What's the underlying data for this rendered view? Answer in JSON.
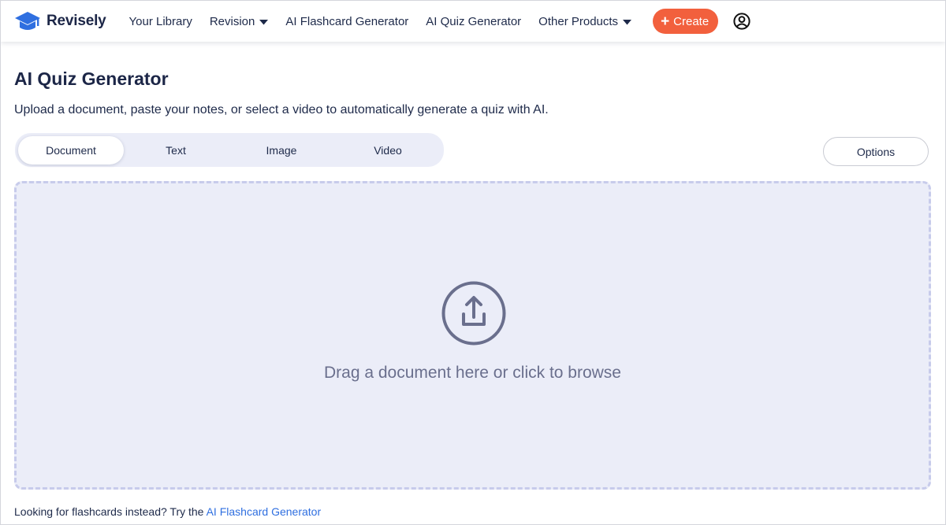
{
  "navbar": {
    "brand": "Revisely",
    "links": {
      "library": "Your Library",
      "revision": "Revision",
      "flashcards": "AI Flashcard Generator",
      "quiz": "AI Quiz Generator",
      "other": "Other Products"
    },
    "create_label": "Create"
  },
  "page": {
    "title": "AI Quiz Generator",
    "subtitle": "Upload a document, paste your notes, or select a video to automatically generate a quiz with AI."
  },
  "tabs": [
    "Document",
    "Text",
    "Image",
    "Video"
  ],
  "active_tab": "Document",
  "options_label": "Options",
  "dropzone": {
    "text": "Drag a document here or click to browse"
  },
  "footer": {
    "prefix": "Looking for flashcards instead? Try the ",
    "link": "AI Flashcard Generator"
  },
  "icons": {
    "logo": "graduation-cap-icon",
    "caret": "caret-down-icon",
    "account": "user-circle-icon",
    "upload": "upload-icon"
  },
  "colors": {
    "accent": "#f2603d",
    "brand_blue": "#2f6fe0",
    "tab_bg": "#ebedf8",
    "dropzone_bg": "#ebedf8",
    "text_dark": "#1e2a4a",
    "dropzone_text": "#6a6f8d"
  }
}
